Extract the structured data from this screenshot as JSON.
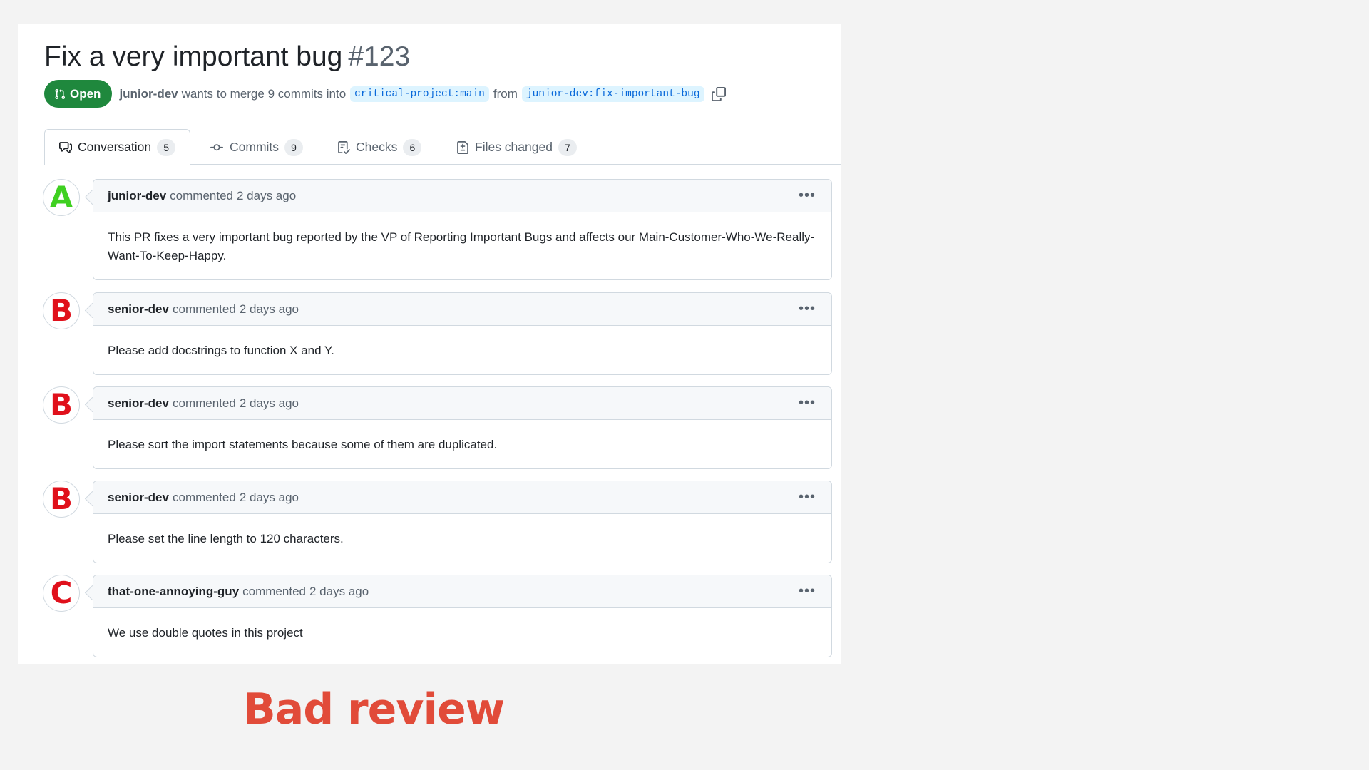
{
  "pr": {
    "title": "Fix a very important bug",
    "number": "#123",
    "state": "Open",
    "state_color": "#1f883d",
    "author": "junior-dev",
    "merge_text": "wants to merge 9 commits into",
    "base_branch": "critical-project:main",
    "from_text": "from",
    "head_branch": "junior-dev:fix-important-bug"
  },
  "tabs": [
    {
      "label": "Conversation",
      "count": "5",
      "icon": "comment-discussion-icon"
    },
    {
      "label": "Commits",
      "count": "9",
      "icon": "git-commit-icon"
    },
    {
      "label": "Checks",
      "count": "6",
      "icon": "checklist-icon"
    },
    {
      "label": "Files changed",
      "count": "7",
      "icon": "file-diff-icon"
    }
  ],
  "comments": [
    {
      "avatar": "A",
      "avatar_color": "#3fd021",
      "author": "junior-dev",
      "verb": "commented",
      "time": "2 days ago",
      "body": "This PR fixes a very important bug reported by the VP of Reporting Important Bugs and affects our Main-Customer-Who-We-Really-Want-To-Keep-Happy."
    },
    {
      "avatar": "B",
      "avatar_color": "#e0101b",
      "author": "senior-dev",
      "verb": "commented",
      "time": "2 days ago",
      "body": "Please add docstrings to function X and Y."
    },
    {
      "avatar": "B",
      "avatar_color": "#e0101b",
      "author": "senior-dev",
      "verb": "commented",
      "time": "2 days ago",
      "body": "Please sort the import statements because some of them are duplicated."
    },
    {
      "avatar": "B",
      "avatar_color": "#e0101b",
      "author": "senior-dev",
      "verb": "commented",
      "time": "2 days ago",
      "body": "Please set the line length to 120 characters."
    },
    {
      "avatar": "C",
      "avatar_color": "#e0101b",
      "author": "that-one-annoying-guy",
      "verb": "commented",
      "time": "2 days ago",
      "body": "We use double quotes in this project"
    }
  ],
  "caption": "Bad review",
  "caption_color": "#e14b39"
}
